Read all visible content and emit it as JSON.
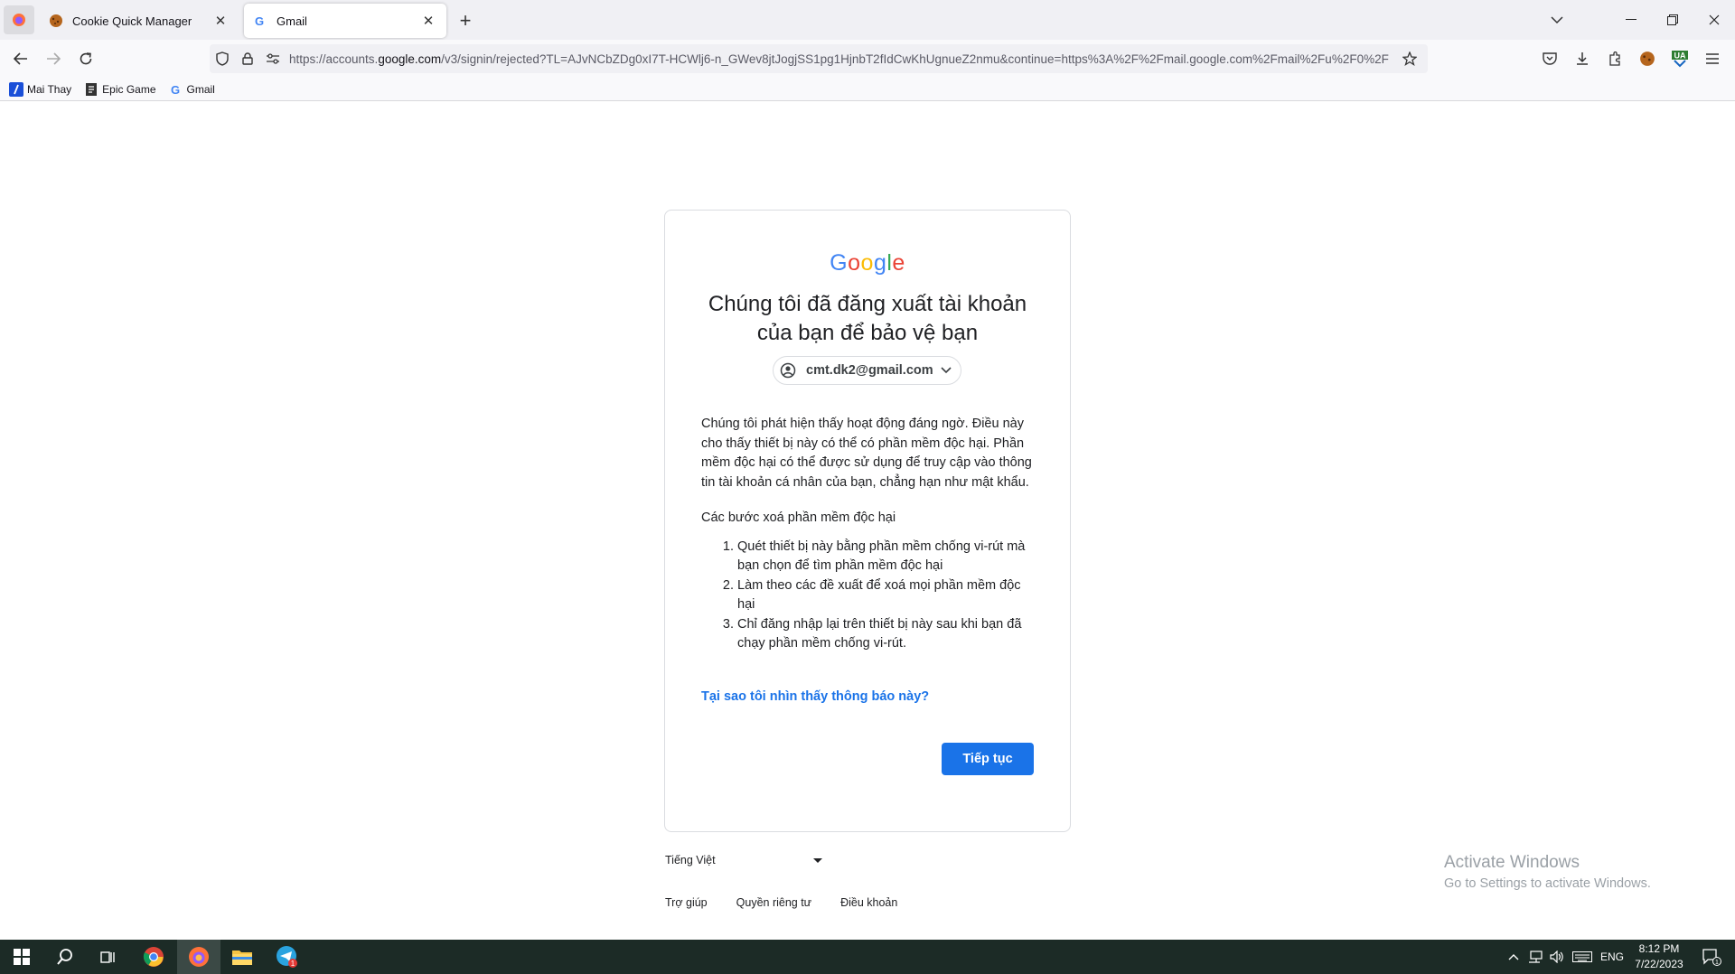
{
  "browser": {
    "tabs": [
      {
        "title": "Cookie Quick Manager",
        "active": false
      },
      {
        "title": "Gmail",
        "active": true
      }
    ],
    "url": {
      "prefix": "https://accounts.",
      "domain": "google.com",
      "rest": "/v3/signin/rejected?TL=AJvNCbZDg0xI7T-HCWlj6-n_GWev8jtJogjSS1pg1HjnbT2fIdCwKhUgnueZ2nmu&continue=https%3A%2F%2Fmail.google.com%2Fmail%2Fu%2F0%2F"
    },
    "bookmarks": [
      {
        "label": "Mai Thay",
        "icon": "bookmark-blue-icon"
      },
      {
        "label": "Epic Game",
        "icon": "bookmark-page-icon"
      },
      {
        "label": "Gmail",
        "icon": "google-g-icon"
      }
    ],
    "extension_badge": "UA"
  },
  "page": {
    "logo": [
      "G",
      "o",
      "o",
      "g",
      "l",
      "e"
    ],
    "logo_colors": [
      "#4285f4",
      "#ea4335",
      "#fbbc05",
      "#4285f4",
      "#34a853",
      "#ea4335"
    ],
    "heading_line1": "Chúng tôi đã đăng xuất tài khoản",
    "heading_line2": "của bạn để bảo vệ bạn",
    "account_email": "cmt.dk2@gmail.com",
    "paragraph": "Chúng tôi phát hiện thấy hoạt động đáng ngờ. Điều này cho thấy thiết bị này có thể có phần mềm độc hại. Phần mềm độc hại có thể được sử dụng để truy cập vào thông tin tài khoản cá nhân của bạn, chẳng hạn như mật khẩu.",
    "steps_title": "Các bước xoá phần mềm độc hại",
    "steps": [
      "Quét thiết bị này bằng phần mềm chống vi-rút mà bạn chọn để tìm phần mềm độc hại",
      "Làm theo các đề xuất để xoá mọi phần mềm độc hại",
      "Chỉ đăng nhập lại trên thiết bị này sau khi bạn đã chạy phần mềm chống vi-rút."
    ],
    "help_link": "Tại sao tôi nhìn thấy thông báo này?",
    "continue_label": "Tiếp tục",
    "accent_color": "#1a73e8"
  },
  "footer": {
    "language": "Tiếng Việt",
    "links": [
      "Trợ giúp",
      "Quyền riêng tư",
      "Điều khoản"
    ]
  },
  "watermark": {
    "line1": "Activate Windows",
    "line2": "Go to Settings to activate Windows."
  },
  "taskbar": {
    "language": "ENG",
    "time": "8:12 PM",
    "date": "7/22/2023",
    "telegram_badge": "1",
    "notification_count": "1"
  }
}
